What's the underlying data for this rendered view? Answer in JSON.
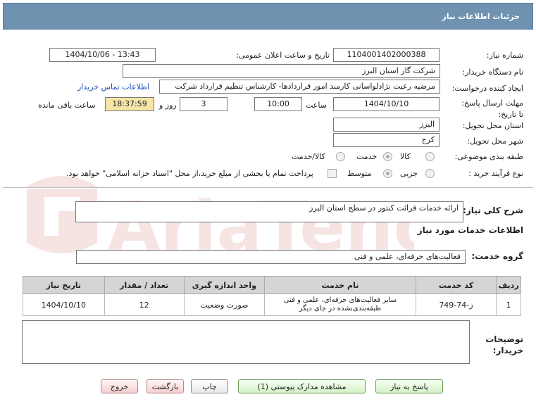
{
  "header": {
    "title": "جزئیات اطلاعات نیاز"
  },
  "form": {
    "need_number_label": "شماره نیاز:",
    "need_number": "1104001402000388",
    "announce_label": "تاریخ و ساعت اعلان عمومی:",
    "announce_value": "1404/10/06 - 13:43",
    "buyer_org_label": "نام دستگاه خریدار:",
    "buyer_org": "شرکت گاز استان البرز",
    "creator_label": "ایجاد کننده درخواست:",
    "creator": "مرضیه رعیت نژادلواسانی کارمند امور قراردادها- کارشناس تنظیم قرارداد شرکت",
    "contact_link": "اطلاعات تماس خریدار",
    "deadline_label": "مهلت ارسال پاسخ: تا تاریخ:",
    "deadline_date": "1404/10/10",
    "time_label": "ساعت",
    "deadline_time": "10:00",
    "days_value": "3",
    "days_label": "روز و",
    "remaining_time": "18:37:59",
    "remaining_label": "ساعت باقی مانده",
    "province_label": "استان محل تحویل:",
    "province": "البرز",
    "city_label": "شهر محل تحویل:",
    "city": "کرج",
    "category_label": "طبقه بندی موضوعی:",
    "category_options": [
      "کالا",
      "خدمت",
      "کالا/خدمت"
    ],
    "process_label": "نوع فرآیند خرید :",
    "process_options": [
      "جزیی",
      "متوسط"
    ],
    "payment_note": "پرداخت تمام یا بخشی از مبلغ خرید،از محل \"اسناد خزانه اسلامی\" خواهد بود."
  },
  "description": {
    "label": "شرح کلی نیاز:",
    "value": "ارائه خدمات قرائت کنتور در سطح استان البرز"
  },
  "services": {
    "section_title": "اطلاعات خدمات مورد نیاز",
    "group_label": "گروه خدمت:",
    "group_value": "فعالیت‌های حرفه‌ای، علمی و فنی",
    "table_headers": [
      "ردیف",
      "کد خدمت",
      "نام خدمت",
      "واحد اندازه گیری",
      "تعداد / مقدار",
      "تاریخ نیاز"
    ],
    "rows": [
      {
        "row": "1",
        "code": "ز-74-749",
        "name": "سایر فعالیت‌های حرفه‌ای، علمی و فنی طبقه‌بندی‌نشده در جای دیگر",
        "unit": "صورت وضعیت",
        "qty": "12",
        "date": "1404/10/10"
      }
    ]
  },
  "buyer_notes": {
    "label": "توضیحات خریدار:",
    "value": ""
  },
  "buttons": {
    "reply": "پاسخ به نیاز",
    "view_docs": "مشاهده مدارک پیوستی (1)",
    "print": "چاپ",
    "back": "بازگشت",
    "exit": "خروج"
  },
  "watermark": {
    "text": "AriaTender.net",
    "color": "#c0392b"
  }
}
